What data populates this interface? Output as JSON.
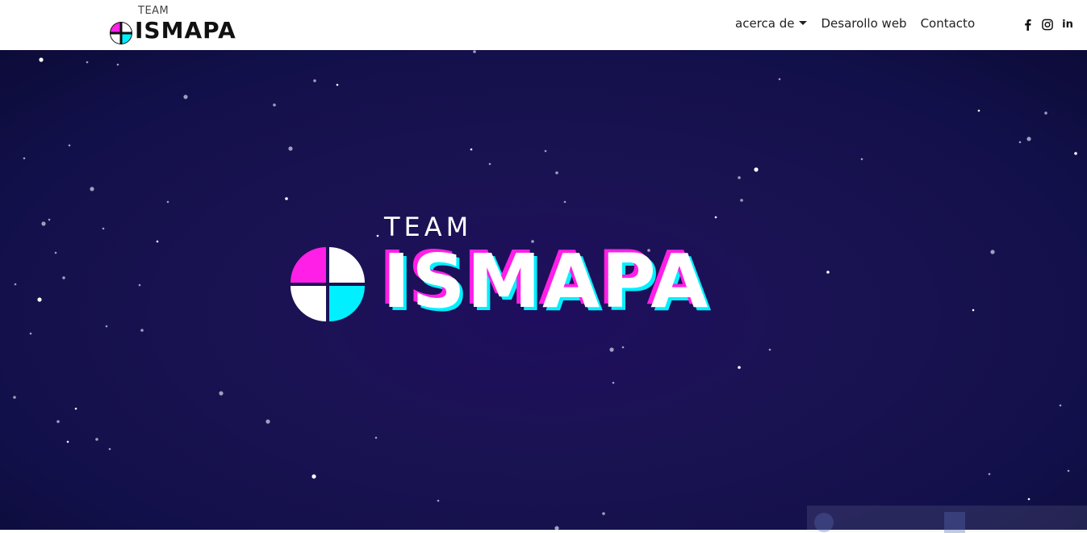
{
  "header": {
    "logo_team": "TEAM",
    "logo_brand": "ISMAPA",
    "nav": [
      {
        "label": "acerca de",
        "has_dropdown": true
      },
      {
        "label": "Desarollo web",
        "has_dropdown": false
      },
      {
        "label": "Contacto",
        "has_dropdown": false
      }
    ],
    "social": [
      {
        "icon": "facebook-icon",
        "glyph": "f"
      },
      {
        "icon": "instagram-icon",
        "glyph": ""
      },
      {
        "icon": "linkedin-icon",
        "glyph": "in"
      }
    ]
  },
  "hero": {
    "team": "TEAM",
    "title": "ISMAPA",
    "colors": {
      "magenta": "#ff1fe6",
      "cyan": "#00f0ff",
      "background": "#1a1352"
    }
  }
}
